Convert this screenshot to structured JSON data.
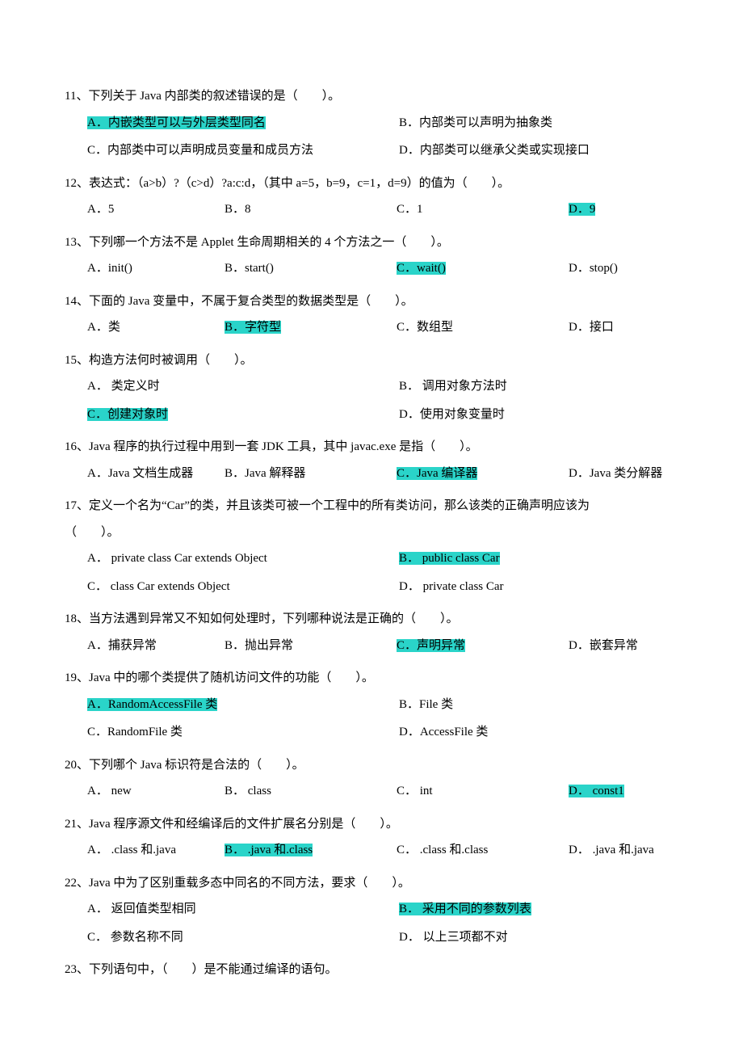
{
  "questions": [
    {
      "num": "11",
      "stem": "下列关于 Java 内部类的叙述错误的是（　　）。",
      "cols": 2,
      "opts": [
        {
          "k": "A",
          "t": "内嵌类型可以与外层类型同名",
          "hl": true
        },
        {
          "k": "B",
          "t": "内部类可以声明为抽象类",
          "hl": false
        },
        {
          "k": "C",
          "t": "内部类中可以声明成员变量和成员方法",
          "hl": false
        },
        {
          "k": "D",
          "t": "内部类可以继承父类或实现接口",
          "hl": false
        }
      ]
    },
    {
      "num": "12",
      "stem": "表达式：（a>b）?（c>d）?a:c:d，（其中 a=5，b=9，c=1，d=9）的值为（　　）。",
      "cols": 4,
      "opts": [
        {
          "k": "A",
          "t": "5",
          "hl": false
        },
        {
          "k": "B",
          "t": "8",
          "hl": false
        },
        {
          "k": "C",
          "t": "1",
          "hl": false
        },
        {
          "k": "D",
          "t": "9",
          "hl": true
        }
      ]
    },
    {
      "num": "13",
      "stem": "下列哪一个方法不是 Applet 生命周期相关的 4 个方法之一（　　）。",
      "cols": 4,
      "opts": [
        {
          "k": "A",
          "t": "init()",
          "hl": false
        },
        {
          "k": "B",
          "t": "start()",
          "hl": false
        },
        {
          "k": "C",
          "t": "wait()",
          "hl": true
        },
        {
          "k": "D",
          "t": "stop()",
          "hl": false
        }
      ]
    },
    {
      "num": "14",
      "stem": "下面的 Java 变量中，不属于复合类型的数据类型是（　　）。",
      "cols": 4,
      "opts": [
        {
          "k": "A",
          "t": "类",
          "hl": false
        },
        {
          "k": "B",
          "t": "字符型",
          "hl": true
        },
        {
          "k": "C",
          "t": "数组型",
          "hl": false
        },
        {
          "k": "D",
          "t": "接口",
          "hl": false
        }
      ]
    },
    {
      "num": "15",
      "stem": "构造方法何时被调用（　　）。",
      "cols": 2,
      "opts": [
        {
          "k": "A",
          "t": " 类定义时",
          "hl": false
        },
        {
          "k": "B",
          "t": " 调用对象方法时",
          "hl": false
        },
        {
          "k": "C",
          "t": "创建对象时",
          "hl": true
        },
        {
          "k": "D",
          "t": "使用对象变量时",
          "hl": false
        }
      ]
    },
    {
      "num": "16",
      "stem": "Java 程序的执行过程中用到一套 JDK 工具，其中 javac.exe 是指（　　）。",
      "cols": 4,
      "opts": [
        {
          "k": "A",
          "t": "Java 文档生成器",
          "hl": false
        },
        {
          "k": "B",
          "t": "Java 解释器",
          "hl": false
        },
        {
          "k": "C",
          "t": "Java 编译器",
          "hl": true
        },
        {
          "k": "D",
          "t": "Java 类分解器",
          "hl": false
        }
      ]
    },
    {
      "num": "17",
      "stem_pre": "定义一个名为“Car”的类，并且该类可被一个工程中的所有类访问，那么该类的正确声明应该为",
      "stem_post": "（　　）。",
      "cols": 2,
      "opts": [
        {
          "k": "A",
          "t": " private class Car extends Object",
          "hl": false
        },
        {
          "k": "B",
          "t": " public class Car",
          "hl": true
        },
        {
          "k": "C",
          "t": " class Car extends Object",
          "hl": false
        },
        {
          "k": "D",
          "t": " private class Car",
          "hl": false
        }
      ]
    },
    {
      "num": "18",
      "stem": "当方法遇到异常又不知如何处理时，下列哪种说法是正确的（　　）。",
      "cols": 4,
      "opts": [
        {
          "k": "A",
          "t": "捕获异常",
          "hl": false
        },
        {
          "k": "B",
          "t": "抛出异常",
          "hl": false
        },
        {
          "k": "C",
          "t": "声明异常",
          "hl": true
        },
        {
          "k": "D",
          "t": "嵌套异常",
          "hl": false
        }
      ]
    },
    {
      "num": "19",
      "stem": "Java 中的哪个类提供了随机访问文件的功能（　　）。",
      "cols": 2,
      "opts": [
        {
          "k": "A",
          "t": "RandomAccessFile 类",
          "hl": true
        },
        {
          "k": "B",
          "t": "File 类",
          "hl": false
        },
        {
          "k": "C",
          "t": "RandomFile 类",
          "hl": false
        },
        {
          "k": "D",
          "t": "AccessFile 类",
          "hl": false
        }
      ]
    },
    {
      "num": "20",
      "stem": "下列哪个 Java 标识符是合法的（　　）。",
      "cols": 4,
      "opts": [
        {
          "k": "A",
          "t": " new",
          "hl": false
        },
        {
          "k": "B",
          "t": " class",
          "hl": false
        },
        {
          "k": "C",
          "t": " int",
          "hl": false
        },
        {
          "k": "D",
          "t": " const1",
          "hl": true
        }
      ]
    },
    {
      "num": "21",
      "stem": "Java 程序源文件和经编译后的文件扩展名分别是（　　）。",
      "cols": 4,
      "opts": [
        {
          "k": "A",
          "t": " .class 和.java",
          "hl": false
        },
        {
          "k": "B",
          "t": " .java 和.class",
          "hl": true
        },
        {
          "k": "C",
          "t": " .class 和.class",
          "hl": false
        },
        {
          "k": "D",
          "t": " .java 和.java",
          "hl": false
        }
      ]
    },
    {
      "num": "22",
      "stem": "Java 中为了区别重载多态中同名的不同方法，要求（　　）。",
      "cols": 2,
      "opts": [
        {
          "k": "A",
          "t": " 返回值类型相同",
          "hl": false
        },
        {
          "k": "B",
          "t": " 采用不同的参数列表",
          "hl": true
        },
        {
          "k": "C",
          "t": " 参数名称不同",
          "hl": false
        },
        {
          "k": "D",
          "t": " 以上三项都不对",
          "hl": false
        }
      ]
    },
    {
      "num": "23",
      "stem": "下列语句中，（　　）是不能通过编译的语句。",
      "cols": 0,
      "opts": []
    }
  ]
}
